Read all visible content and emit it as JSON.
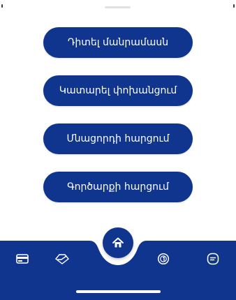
{
  "actions": {
    "view_details_label": "Դիտել մանրամասն",
    "make_transfer_label": "Կատարել փոխանցում",
    "balance_inquiry_label": "Մնացորդի հարցում",
    "transactions_inquiry_label": "Գործարքի հարցում"
  },
  "tabbar": {
    "background": "#0f358f",
    "icons": [
      "card-icon",
      "diamond-check-icon",
      "home-icon",
      "coin-icon",
      "chat-icon"
    ]
  },
  "colors": {
    "accent": "#0f358f",
    "button_text": "#ffffff"
  }
}
